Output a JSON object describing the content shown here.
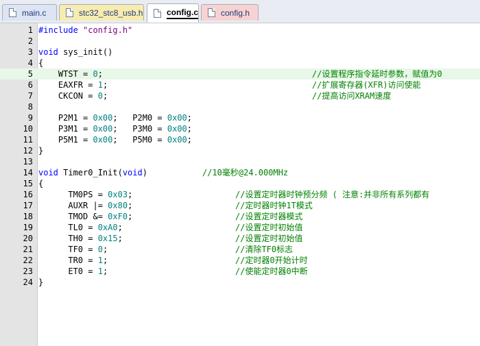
{
  "tabs": [
    {
      "label": "main.c",
      "color": "#dde4f3"
    },
    {
      "label": "stc32_stc8_usb.h",
      "color": "#f6ecb0"
    },
    {
      "label": "config.c",
      "color": "#ffffff"
    },
    {
      "label": "config.h",
      "color": "#f8d2d2"
    }
  ],
  "active_tab": "config.c",
  "lines": [
    {
      "n": "1",
      "code": "#include \"config.h\""
    },
    {
      "n": "2",
      "code": ""
    },
    {
      "n": "3",
      "code": "void sys_init()"
    },
    {
      "n": "4",
      "code": "{"
    },
    {
      "n": "5",
      "code": "    WTST = 0;",
      "comment": "//设置程序指令延时参数，赋值为0"
    },
    {
      "n": "6",
      "code": "    EAXFR = 1;",
      "comment": "//扩展寄存器(XFR)访问使能"
    },
    {
      "n": "7",
      "code": "    CKCON = 0;",
      "comment": "//提高访问XRAM速度"
    },
    {
      "n": "8",
      "code": ""
    },
    {
      "n": "9",
      "code": "    P2M1 = 0x00;   P2M0 = 0x00;"
    },
    {
      "n": "10",
      "code": "    P3M1 = 0x00;   P3M0 = 0x00;"
    },
    {
      "n": "11",
      "code": "    P5M1 = 0x00;   P5M0 = 0x00;"
    },
    {
      "n": "12",
      "code": "}"
    },
    {
      "n": "13",
      "code": ""
    },
    {
      "n": "14",
      "code": "void Timer0_Init(void)",
      "comment": "//10毫秒@24.000MHz"
    },
    {
      "n": "15",
      "code": "{"
    },
    {
      "n": "16",
      "code": "      TM0PS = 0x03;",
      "comment": "//设置定时器时钟预分频 ( 注意:并非所有系列都有"
    },
    {
      "n": "17",
      "code": "      AUXR |= 0x80;",
      "comment": "//定时器时钟1T模式"
    },
    {
      "n": "18",
      "code": "      TMOD &= 0xF0;",
      "comment": "//设置定时器模式"
    },
    {
      "n": "19",
      "code": "      TL0 = 0xA0;",
      "comment": "//设置定时初始值"
    },
    {
      "n": "20",
      "code": "      TH0 = 0x15;",
      "comment": "//设置定时初始值"
    },
    {
      "n": "21",
      "code": "      TF0 = 0;",
      "comment": "//清除TF0标志"
    },
    {
      "n": "22",
      "code": "      TR0 = 1;",
      "comment": "//定时器0开始计时"
    },
    {
      "n": "23",
      "code": "      ET0 = 1;",
      "comment": "//使能定时器0中断"
    },
    {
      "n": "24",
      "code": "}"
    }
  ],
  "highlighted_line": "5"
}
